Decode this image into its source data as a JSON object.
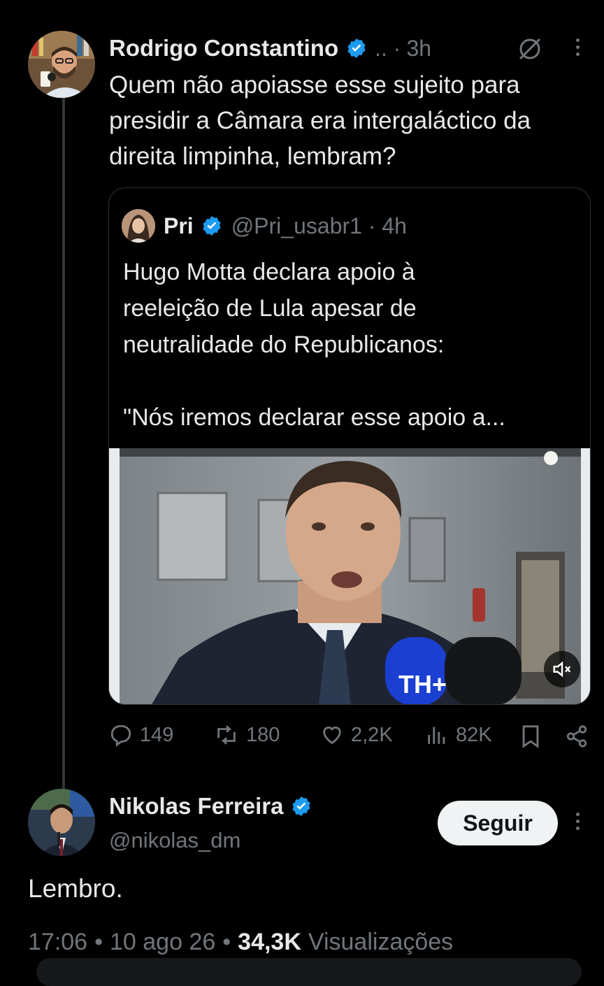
{
  "tweet": {
    "author_name": "Rodrigo Constantino",
    "separator": ".. ·",
    "time": "3h",
    "text": "Quem não apoiasse esse sujeito para presidir a Câmara era intergaláctico da direita limpinha, lembram?"
  },
  "quote": {
    "author_name": "Pri",
    "handle_time": "@Pri_usabr1 · 4h",
    "text_line1": "Hugo Motta declara apoio à",
    "text_line2": "reeleição de Lula apesar de",
    "text_line3": "neutralidade do Republicanos:",
    "text_line4": "\"Nós iremos declarar esse apoio a...",
    "video_mic_logo": "TH+"
  },
  "actions": {
    "replies": "149",
    "retweets": "180",
    "likes": "2,2K",
    "views": "82K"
  },
  "reply": {
    "author_name": "Nikolas Ferreira",
    "handle": "@nikolas_dm",
    "follow_label": "Seguir",
    "text": "Lembro.",
    "time": "17:06",
    "date": "10 ago 26",
    "views_count": "34,3K",
    "views_label": "Visualizações",
    "dot": "•"
  },
  "colors": {
    "background": "#000000",
    "text_primary": "#e7e9ea",
    "text_muted": "#71767b",
    "verified_blue": "#1d9bf0",
    "button_bg": "#eff3f4"
  }
}
